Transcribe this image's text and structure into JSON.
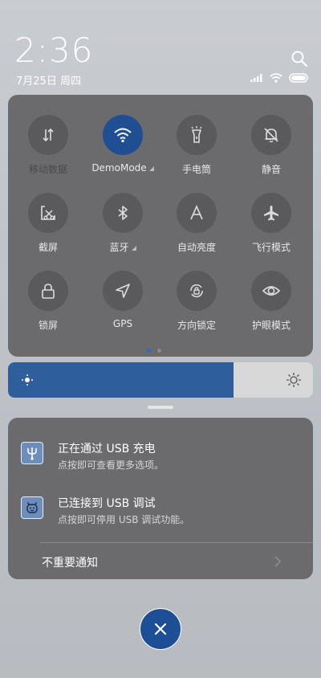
{
  "status": {
    "time": "2:36",
    "date": "7月25日 周四"
  },
  "quick_settings": {
    "tiles": [
      {
        "id": "mobile-data",
        "label": "移动数据",
        "active": false,
        "dim": true,
        "icon": "mobile-data-icon"
      },
      {
        "id": "wifi",
        "label": "DemoMode",
        "active": true,
        "dim": false,
        "icon": "wifi-icon",
        "has_more": true
      },
      {
        "id": "flashlight",
        "label": "手电筒",
        "active": false,
        "dim": false,
        "icon": "flashlight-icon"
      },
      {
        "id": "mute",
        "label": "静音",
        "active": false,
        "dim": false,
        "icon": "mute-bell-icon"
      },
      {
        "id": "screenshot",
        "label": "截屏",
        "active": false,
        "dim": false,
        "icon": "screenshot-icon"
      },
      {
        "id": "bluetooth",
        "label": "蓝牙",
        "active": false,
        "dim": false,
        "icon": "bluetooth-icon",
        "has_more": true
      },
      {
        "id": "auto-brightness",
        "label": "自动亮度",
        "active": false,
        "dim": false,
        "icon": "auto-brightness-icon"
      },
      {
        "id": "airplane",
        "label": "飞行模式",
        "active": false,
        "dim": false,
        "icon": "airplane-icon"
      },
      {
        "id": "lock-screen",
        "label": "锁屏",
        "active": false,
        "dim": false,
        "icon": "lock-icon"
      },
      {
        "id": "gps",
        "label": "GPS",
        "active": false,
        "dim": false,
        "icon": "location-arrow-icon"
      },
      {
        "id": "rotation-lock",
        "label": "方向锁定",
        "active": false,
        "dim": false,
        "icon": "rotation-lock-icon"
      },
      {
        "id": "eye-care",
        "label": "护眼模式",
        "active": false,
        "dim": false,
        "icon": "eye-icon"
      }
    ],
    "page_count": 2,
    "current_page": 0
  },
  "brightness": {
    "level": 0.74
  },
  "notifications": [
    {
      "title": "正在通过 USB 充电",
      "subtitle": "点按即可查看更多选项。",
      "icon": "usb-icon"
    },
    {
      "title": "已连接到 USB 调试",
      "subtitle": "点按即可停用 USB 调试功能。",
      "icon": "android-debug-icon"
    }
  ],
  "unimportant_label": "不重要通知",
  "colors": {
    "accent": "#1f4e92",
    "panel": "#6b6b6d",
    "tile": "#5a5a5c"
  }
}
